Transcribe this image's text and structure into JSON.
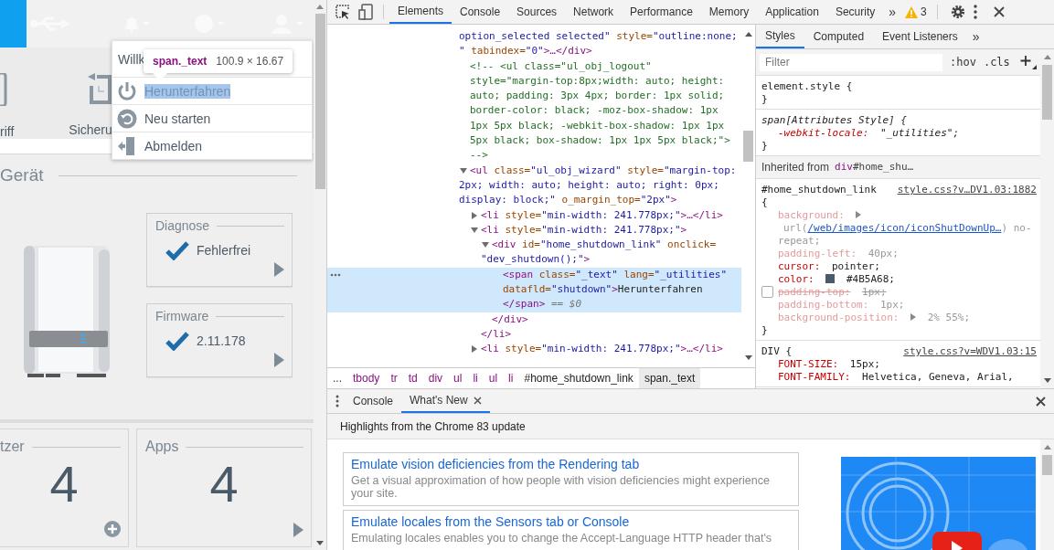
{
  "page": {
    "toolbar_labels": [
      "riff",
      "Sicheru"
    ],
    "section_title": "Gerät",
    "status_cards": [
      {
        "title": "Diagnose",
        "value": "Fehlerfrei"
      },
      {
        "title": "Firmware",
        "value": "2.11.178"
      }
    ],
    "count_cards": [
      {
        "title": "tzer",
        "count": "4",
        "kind": "add"
      },
      {
        "title": "Apps",
        "count": "4",
        "kind": "open"
      }
    ],
    "menu": {
      "greeting": "Willk",
      "items": [
        {
          "label": "Herunterfahren",
          "kind": "power",
          "selected": true
        },
        {
          "label": "Neu starten",
          "kind": "restart",
          "selected": false
        },
        {
          "label": "Abmelden",
          "kind": "logout",
          "selected": false
        }
      ]
    },
    "inspect_tooltip": {
      "selector": "span._text",
      "size": "100.9 × 16.67"
    }
  },
  "devtools": {
    "tabs": [
      {
        "label": "Elements",
        "selected": true
      },
      {
        "label": "Console",
        "selected": false
      },
      {
        "label": "Sources",
        "selected": false
      },
      {
        "label": "Network",
        "selected": false
      },
      {
        "label": "Performance",
        "selected": false
      },
      {
        "label": "Memory",
        "selected": false
      },
      {
        "label": "Application",
        "selected": false
      },
      {
        "label": "Security",
        "selected": false
      }
    ],
    "more_tabs": "»",
    "warning_count": "3",
    "elements": {
      "nodes": [
        {
          "kind": "continued",
          "selected": false,
          "lines": [
            [
              {
                "kind": "value",
                "t": "option_selected selected\""
              },
              {
                "kind": "attr",
                "t": " style="
              },
              {
                "kind": "value",
                "t": "\"outline:none;"
              }
            ],
            [
              {
                "kind": "value",
                "t": "\" "
              },
              {
                "kind": "attr",
                "t": "tabindex="
              },
              {
                "kind": "value",
                "t": "\"0\""
              },
              {
                "kind": "tag",
                "t": ">…</div>"
              }
            ]
          ]
        },
        {
          "kind": "plain",
          "selected": false,
          "lines": [
            [
              {
                "kind": "comment",
                "t": "<!--    <ul class=\"ul_obj_logout\""
              }
            ],
            [
              {
                "kind": "comment",
                "t": "style=\"margin-top:8px;width: auto; height:"
              }
            ],
            [
              {
                "kind": "comment",
                "t": "auto; padding: 3px 4px; border: 1px solid;"
              }
            ],
            [
              {
                "kind": "comment",
                "t": "border-color: black; -moz-box-shadow: 1px"
              }
            ],
            [
              {
                "kind": "comment",
                "t": "1px 5px black; -webkit-box-shadow: 1px 1px"
              }
            ],
            [
              {
                "kind": "comment",
                "t": "5px black; box-shadow: 1px 1px 5px black;\">"
              }
            ],
            [
              {
                "kind": "comment",
                "t": "-->"
              }
            ]
          ]
        },
        {
          "kind": "expanded",
          "selected": false,
          "lines": [
            [
              {
                "kind": "tag",
                "t": "<ul"
              },
              {
                "kind": "attr",
                "t": " class="
              },
              {
                "kind": "value",
                "t": "\"ul_obj_wizard\""
              },
              {
                "kind": "attr",
                "t": " style="
              },
              {
                "kind": "value",
                "t": "\"margin-top:"
              }
            ],
            [
              {
                "kind": "value",
                "t": "2px; width: auto; height: auto; right: 0px;"
              }
            ],
            [
              {
                "kind": "value",
                "t": "display: block;\""
              },
              {
                "kind": "attr",
                "t": " o_margin_top="
              },
              {
                "kind": "value",
                "t": "\"2px\""
              },
              {
                "kind": "tag",
                "t": ">"
              }
            ]
          ],
          "children": [
            {
              "kind": "collapsed",
              "selected": false,
              "lines": [
                [
                  {
                    "kind": "tag",
                    "t": "<li"
                  },
                  {
                    "kind": "attr",
                    "t": " style="
                  },
                  {
                    "kind": "value",
                    "t": "\"min-width: 241.778px;\""
                  },
                  {
                    "kind": "tag",
                    "t": ">…</li>"
                  }
                ]
              ]
            },
            {
              "kind": "expanded",
              "selected": false,
              "lines": [
                [
                  {
                    "kind": "tag",
                    "t": "<li"
                  },
                  {
                    "kind": "attr",
                    "t": " style="
                  },
                  {
                    "kind": "value",
                    "t": "\"min-width: 241.778px;\""
                  },
                  {
                    "kind": "tag",
                    "t": ">"
                  }
                ]
              ],
              "children": [
                {
                  "kind": "expanded",
                  "selected": false,
                  "lines": [
                    [
                      {
                        "kind": "tag",
                        "t": "<div"
                      },
                      {
                        "kind": "attr",
                        "t": " id="
                      },
                      {
                        "kind": "value",
                        "t": "\"home_shutdown_link\""
                      },
                      {
                        "kind": "attr",
                        "t": " onclick="
                      }
                    ],
                    [
                      {
                        "kind": "value",
                        "t": "\"dev_shutdown();\""
                      },
                      {
                        "kind": "tag",
                        "t": ">"
                      }
                    ]
                  ],
                  "children": [
                    {
                      "kind": "plain",
                      "selected": true,
                      "lines": [
                        [
                          {
                            "kind": "tag",
                            "t": "<span"
                          },
                          {
                            "kind": "attr",
                            "t": " class="
                          },
                          {
                            "kind": "value",
                            "t": "\"_text\""
                          },
                          {
                            "kind": "attr",
                            "t": " lang="
                          },
                          {
                            "kind": "value",
                            "t": "\"_utilities\""
                          }
                        ],
                        [
                          {
                            "kind": "attr",
                            "t": "datafld="
                          },
                          {
                            "kind": "value",
                            "t": "\"shutdown\""
                          },
                          {
                            "kind": "tag",
                            "t": ">"
                          },
                          {
                            "kind": "text",
                            "t": "Herunterfahren"
                          }
                        ],
                        [
                          {
                            "kind": "tag",
                            "t": "</span>"
                          },
                          {
                            "kind": "meta",
                            "t": " == $0"
                          }
                        ]
                      ]
                    }
                  ],
                  "close": [
                    {
                      "kind": "tag",
                      "t": "</div>"
                    }
                  ]
                }
              ],
              "close": [
                {
                  "kind": "tag",
                  "t": "</li>"
                }
              ]
            },
            {
              "kind": "collapsed",
              "selected": false,
              "lines": [
                [
                  {
                    "kind": "tag",
                    "t": "<li"
                  },
                  {
                    "kind": "attr",
                    "t": " style="
                  },
                  {
                    "kind": "value",
                    "t": "\"min-width: 241.778px;\""
                  },
                  {
                    "kind": "tag",
                    "t": ">…</li>"
                  }
                ]
              ]
            }
          ]
        }
      ]
    },
    "breadcrumbs": [
      {
        "label": "...",
        "kind": "more",
        "selected": false
      },
      {
        "label": "tbody",
        "kind": "tag",
        "selected": false
      },
      {
        "label": "tr",
        "kind": "tag",
        "selected": false
      },
      {
        "label": "td",
        "kind": "tag",
        "selected": false
      },
      {
        "label": "div",
        "kind": "tag",
        "selected": false
      },
      {
        "label": "ul",
        "kind": "tag",
        "selected": false
      },
      {
        "label": "li",
        "kind": "tag",
        "selected": false
      },
      {
        "label": "ul",
        "kind": "tag",
        "selected": false
      },
      {
        "label": "li",
        "kind": "tag",
        "selected": false
      },
      {
        "label": "#home_shutdown_link",
        "kind": "id",
        "selected": false
      },
      {
        "label": "span._text",
        "kind": "id",
        "selected": true
      }
    ],
    "styles": {
      "tabs": [
        {
          "label": "Styles",
          "selected": true
        },
        {
          "label": "Computed",
          "selected": false
        },
        {
          "label": "Event Listeners",
          "selected": false
        }
      ],
      "more_tabs": "»",
      "filter": {
        "placeholder": "Filter"
      },
      "buttons": [
        ":hov",
        ".cls"
      ],
      "rules": [
        {
          "kind": "element",
          "selector": "element.style {",
          "close": "}"
        },
        {
          "kind": "attributes",
          "selector": "span[Attributes Style] {",
          "props": [
            {
              "name": "-webkit-locale:",
              "value": "\"_utilities\";",
              "kind": "active",
              "enabled": true,
              "expandable": false
            }
          ],
          "close": "}"
        },
        {
          "kind": "inherited",
          "label": "Inherited from",
          "tag": "div",
          "id": "#home_shu…"
        },
        {
          "kind": "rule",
          "selector": "#home_shutdown_link",
          "source": "style.css?v…DV1.03:1882",
          "open": "{",
          "props": [
            {
              "name": "background:",
              "expandable": true,
              "value": "url(",
              "link": "/web/images/icon/iconShutDownUp…",
              "value_after": ") no-repeat;",
              "kind": "faded",
              "enabled": true
            },
            {
              "name": "padding-left:",
              "expandable": false,
              "value": "40px;",
              "kind": "faded",
              "enabled": true
            },
            {
              "name": "cursor:",
              "expandable": false,
              "value": "pointer;",
              "kind": "active",
              "enabled": true
            },
            {
              "name": "color:",
              "expandable": false,
              "color": "#4b5a68",
              "value": "#4B5A68;",
              "kind": "active",
              "enabled": true
            },
            {
              "name": "padding-top:",
              "expandable": false,
              "value": "1px;",
              "kind": "faded",
              "enabled": false
            },
            {
              "name": "padding-bottom:",
              "expandable": false,
              "value": "1px;",
              "kind": "faded",
              "enabled": true
            },
            {
              "name": "background-position:",
              "expandable": true,
              "value": "2% 55%;",
              "kind": "faded",
              "enabled": true
            }
          ],
          "close": "}"
        },
        {
          "kind": "rule",
          "selector": "DIV {",
          "source": "style.css?v=WDV1.03:15",
          "props": [
            {
              "name": "FONT-SIZE:",
              "expandable": false,
              "value": "15px;",
              "kind": "active",
              "enabled": true
            },
            {
              "name": "FONT-FAMILY:",
              "expandable": false,
              "value": "Helvetica, Geneva, Arial,",
              "kind": "active",
              "enabled": true
            }
          ]
        }
      ]
    },
    "drawer": {
      "tabs": [
        {
          "label": "Console",
          "selected": false,
          "closable": false
        },
        {
          "label": "What's New",
          "selected": true,
          "closable": true
        }
      ],
      "headline": "Highlights from the Chrome 83 update",
      "articles": [
        {
          "title": "Emulate vision deficiencies from the Rendering tab",
          "description": "Get a visual approximation of how people with vision deficiencies might experience your site."
        },
        {
          "title": "Emulate locales from the Sensors tab or Console",
          "description": "Emulating locales enables you to change the Accept-Language HTTP header that's"
        }
      ]
    }
  }
}
